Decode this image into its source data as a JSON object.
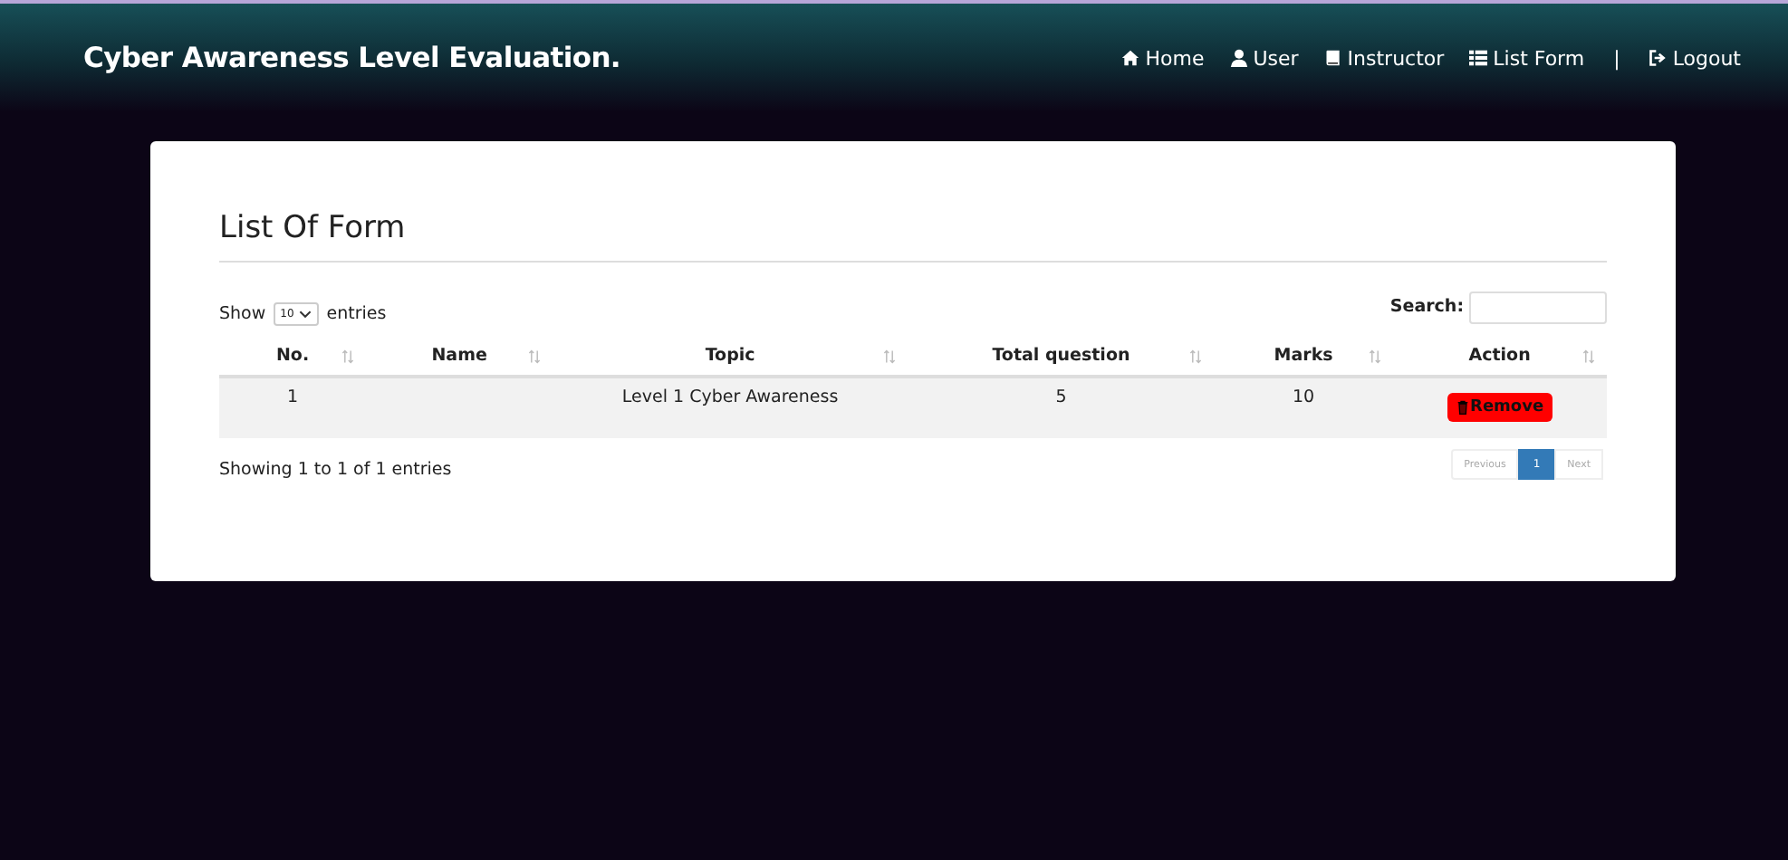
{
  "brand": "Cyber Awareness Level Evaluation.",
  "nav": [
    {
      "label": "Home",
      "kind": "home"
    },
    {
      "label": "User",
      "kind": "user"
    },
    {
      "label": "Instructor",
      "kind": "book"
    },
    {
      "label": "List Form",
      "kind": "list"
    },
    {
      "label": "|",
      "kind": "separator"
    },
    {
      "label": "Logout",
      "kind": "logout"
    }
  ],
  "card": {
    "title": "List Of Form",
    "length": {
      "before": "Show",
      "value": "10",
      "after": "entries"
    },
    "search": {
      "label": "Search:"
    },
    "table": {
      "columns": [
        "No.",
        "Name",
        "Topic",
        "Total question",
        "Marks",
        "Action"
      ],
      "rows": [
        {
          "cells": [
            "1",
            "",
            "Level 1 Cyber Awareness",
            "5",
            "10"
          ],
          "action": "Remove"
        }
      ]
    },
    "info": "Showing 1 to 1 of 1 entries",
    "pagination": [
      {
        "label": "Previous",
        "kind": "prev",
        "selected": false
      },
      {
        "label": "1",
        "kind": "page",
        "selected": true
      },
      {
        "label": "Next",
        "kind": "next",
        "selected": false
      }
    ]
  }
}
